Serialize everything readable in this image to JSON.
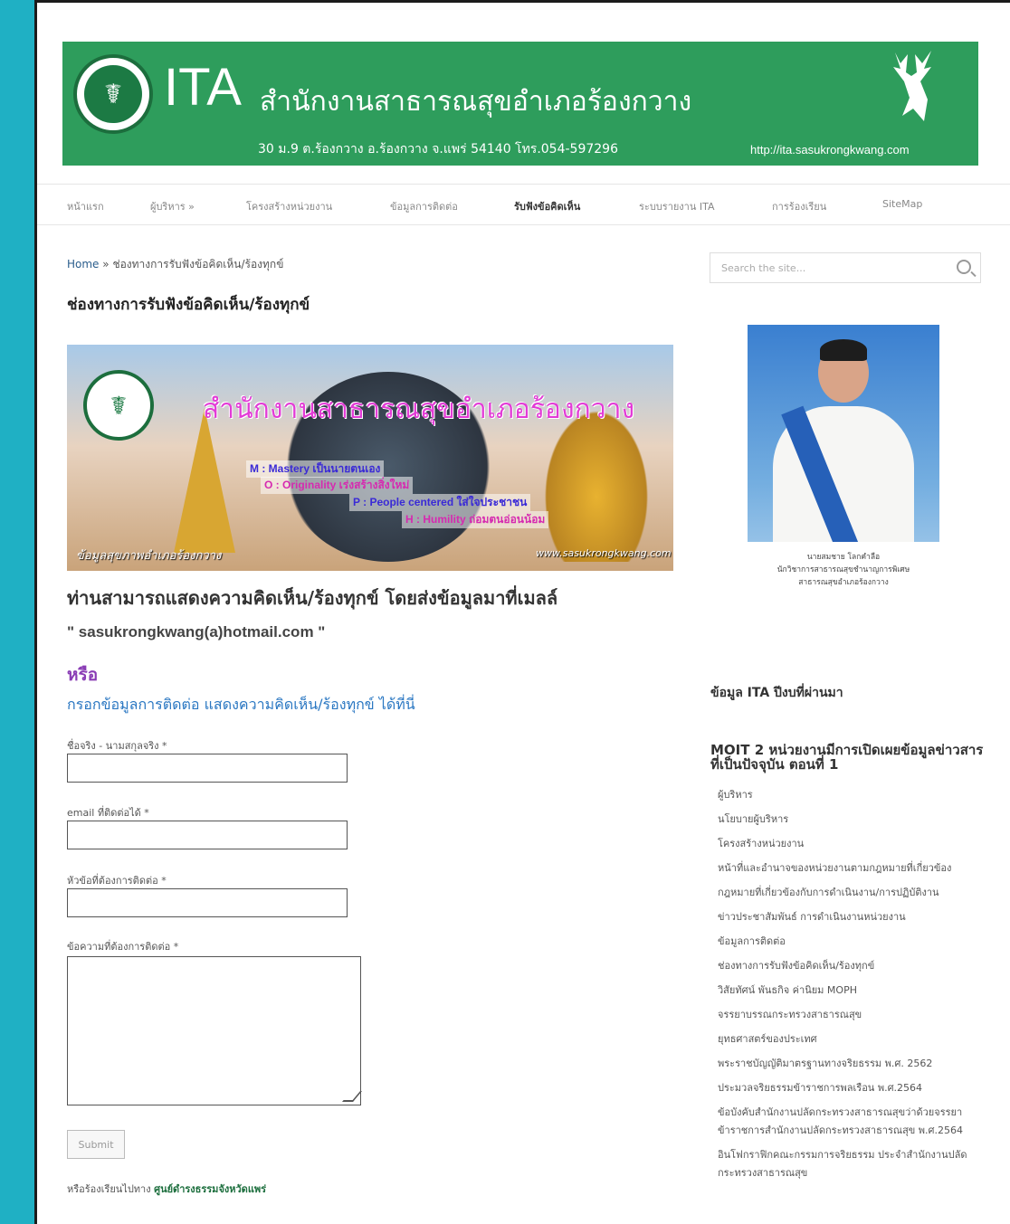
{
  "header": {
    "logo_text": "ITA",
    "title": "สำนักงานสาธารณสุขอำเภอร้องกวาง",
    "address": "30 ม.9 ต.ร้องกวาง อ.ร้องกวาง จ.แพร่ 54140 โทร.054-597296",
    "url": "http://ita.sasukrongkwang.com"
  },
  "nav": {
    "items": [
      {
        "label": "หน้าแรก"
      },
      {
        "label": "ผู้บริหาร »"
      },
      {
        "label": "โครงสร้างหน่วยงาน"
      },
      {
        "label": "ข้อมูลการติดต่อ"
      },
      {
        "label": "รับฟังข้อคิดเห็น"
      },
      {
        "label": "ระบบรายงาน ITA"
      },
      {
        "label": "การร้องเรียน"
      },
      {
        "label": "SiteMap"
      }
    ]
  },
  "breadcrumb": {
    "home": "Home",
    "sep": "»",
    "current": "ช่องทางการรับฟังข้อคิดเห็น/ร้องทุกข์"
  },
  "page_title": "ช่องทางการรับฟังข้อคิดเห็น/ร้องทุกข์",
  "banner": {
    "title": "สำนักงานสาธารณสุขอำเภอร้องกวาง",
    "m": "M : Mastery เป็นนายตนเอง",
    "o": "O : Originality เร่งสร้างสิ่งใหม่",
    "p": "P : People centered ใส่ใจประชาชน",
    "h": "H : Humility ถ่อมตนอ่อนน้อม",
    "footer_left": "ข้อมูลสุขภาพอำเภอร้องกวาง",
    "footer_right": "www.sasukrongkwang.com"
  },
  "content": {
    "intro": "ท่านสามารถแสดงความคิดเห็น/ร้องทุกข์ โดยส่งข้อมูลมาที่เมลล์",
    "email": "\" sasukrongkwang(a)hotmail.com \"",
    "or": "หรือ",
    "form_heading": "กรอกข้อมูลการติดต่อ แสดงความคิดเห็น/ร้องทุกข์ ได้ที่นี่"
  },
  "form": {
    "name_label": "ชื่อจริง - นามสกุลจริง *",
    "email_label": "email ที่ติดต่อได้ *",
    "subject_label": "หัวข้อที่ต้องการติดต่อ *",
    "message_label": "ข้อความที่ต้องการติดต่อ *",
    "submit": "Submit"
  },
  "footer_note": {
    "prefix": "หรือร้องเรียนไปทาง",
    "link": "ศูนย์ดำรงธรรมจังหวัดแพร่"
  },
  "sidebar": {
    "search_placeholder": "Search the site...",
    "portrait_caption": [
      "นายสมชาย โลกคำลือ",
      "นักวิชาการสาธารณสุขชำนาญการพิเศษ",
      "สาธารณสุขอำเภอร้องกวาง"
    ],
    "heading1": "ข้อมูล ITA ปีงบที่ผ่านมา",
    "heading2": "MOIT 2 หน่วยงานมีการเปิดเผยข้อมูลข่าวสารที่เป็นปัจจุบัน ตอนที่ 1",
    "items": [
      "ผู้บริหาร",
      "นโยบายผู้บริหาร",
      "โครงสร้างหน่วยงาน",
      "หน้าที่และอำนาจของหน่วยงานตามกฎหมายที่เกี่ยวข้อง",
      "กฎหมายที่เกี่ยวข้องกับการดำเนินงาน/การปฏิบัติงาน",
      "ข่าวประชาสัมพันธ์ การดำเนินงานหน่วยงาน",
      "ข้อมูลการติดต่อ",
      "ช่องทางการรับฟังข้อคิดเห็น/ร้องทุกข์",
      "วิสัยทัศน์ พันธกิจ ค่านิยม MOPH",
      "จรรยาบรรณกระทรวงสาธารณสุข",
      "ยุทธศาสตร์ของประเทศ",
      "พระราชบัญญัติมาตรฐานทางจริยธรรม พ.ศ. 2562",
      "ประมวลจริยธรรมข้าราชการพลเรือน พ.ศ.2564",
      "ข้อบังคับสำนักงานปลัดกระทรวงสาธารณสุขว่าด้วยจรรยาข้าราชการสำนักงานปลัดกระทรวงสาธารณสุข พ.ศ.2564",
      "อินโฟกราฟิกคณะกรรมการจริยธรรม ประจำสำนักงานปลัดกระทรวงสาธารณสุข"
    ]
  }
}
